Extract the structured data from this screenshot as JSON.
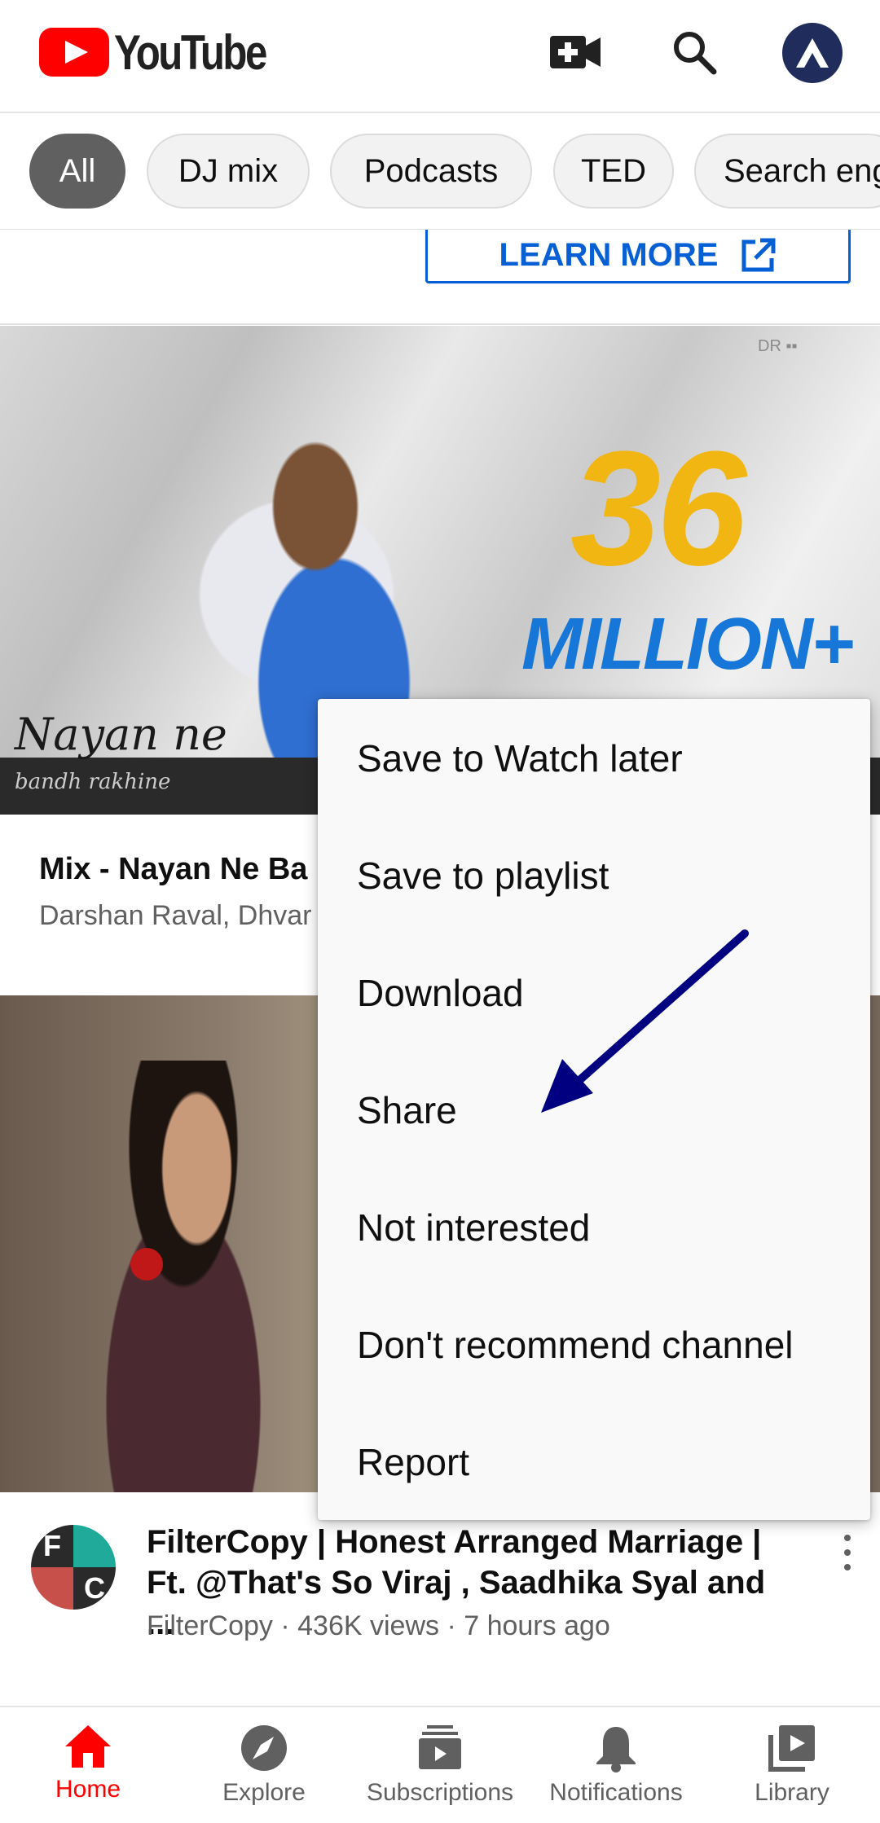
{
  "header": {
    "logo_text": "YouTube",
    "icons": [
      "video-camera-plus-icon",
      "search-icon",
      "account-avatar"
    ]
  },
  "chips": [
    "All",
    "DJ mix",
    "Podcasts",
    "TED",
    "Search eng"
  ],
  "ad": {
    "learn_more": "LEARN MORE"
  },
  "video1": {
    "thumbnail_text": {
      "big": "36",
      "million": "MILLION+",
      "script_title": "Nayan ne",
      "script_sub": "bandh rakhine"
    },
    "title": "Mix - Nayan Ne Ba",
    "subtitle": "Darshan Raval, Dhvar"
  },
  "video2": {
    "channel_avatar_letters": [
      "F",
      "",
      "",
      "C"
    ],
    "title": "FilterCopy | Honest Arranged Marriage | Ft. @That's So Viraj , Saadhika Syal and ...",
    "subtitle": "FilterCopy · 436K views · 7 hours ago"
  },
  "menu": {
    "items": [
      "Save to Watch later",
      "Save to playlist",
      "Download",
      "Share",
      "Not interested",
      "Don't recommend channel",
      "Report"
    ]
  },
  "bottom_nav": [
    {
      "label": "Home",
      "icon": "home-icon",
      "active": true
    },
    {
      "label": "Explore",
      "icon": "compass-icon",
      "active": false
    },
    {
      "label": "Subscriptions",
      "icon": "subscriptions-icon",
      "active": false
    },
    {
      "label": "Notifications",
      "icon": "bell-icon",
      "active": false
    },
    {
      "label": "Library",
      "icon": "library-icon",
      "active": false
    }
  ],
  "colors": {
    "brand_red": "#ff0000",
    "link_blue": "#065fd4",
    "annotation_arrow": "#000080"
  }
}
